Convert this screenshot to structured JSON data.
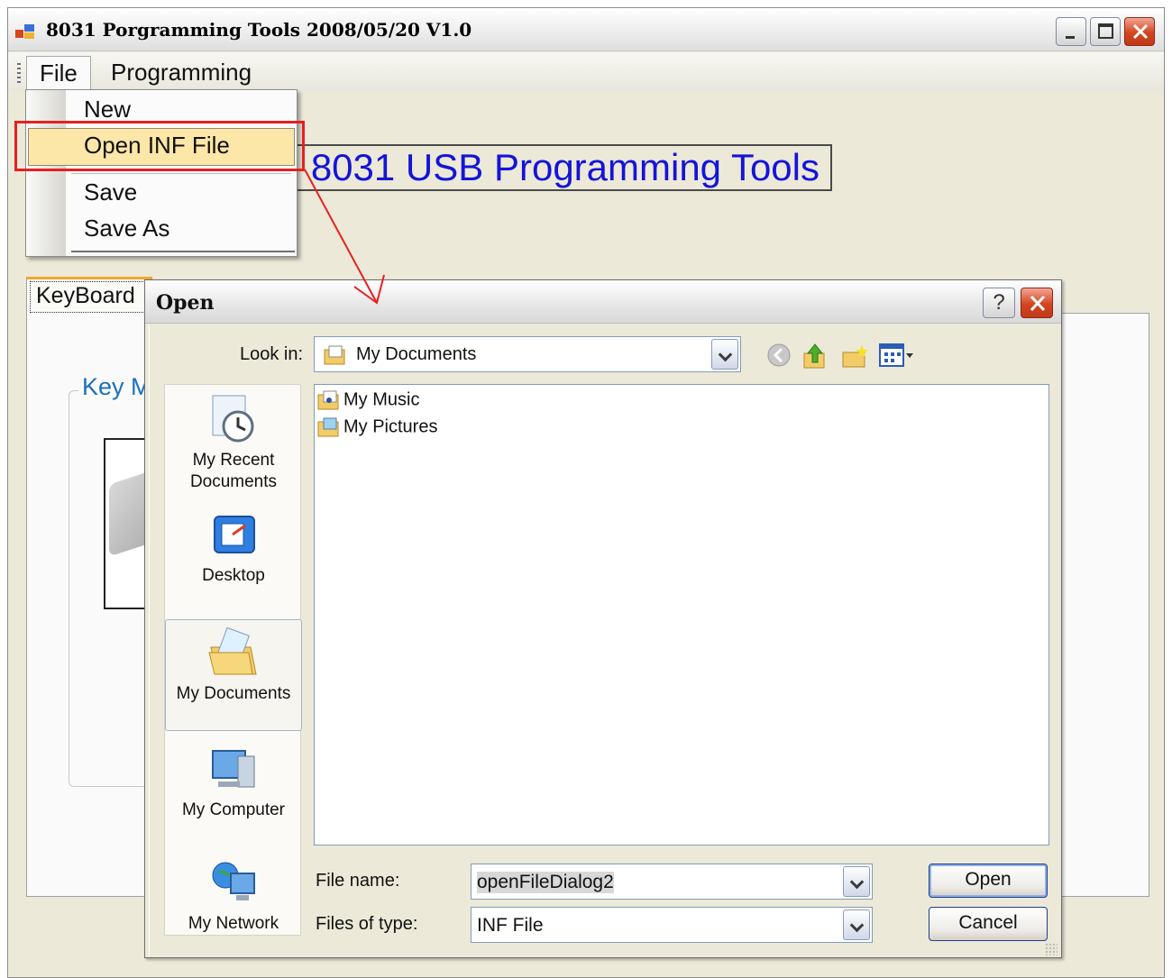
{
  "window": {
    "title": "8031 Porgramming Tools 2008/05/20 V1.0"
  },
  "menubar": {
    "file": "File",
    "programming": "Programming"
  },
  "file_menu": {
    "items": [
      "New",
      "Open INF File",
      "Save",
      "Save As"
    ],
    "highlighted": "Open INF File"
  },
  "main": {
    "heading": "8031 USB Programming Tools",
    "tab_keyboard": "KeyBoard",
    "group_label": "Key M"
  },
  "open_dialog": {
    "title": "Open",
    "help": "?",
    "look_in_label": "Look in:",
    "look_in_value": "My Documents",
    "places": [
      "My Recent Documents",
      "Desktop",
      "My Documents",
      "My Computer",
      "My Network"
    ],
    "selected_place": "My Documents",
    "files": [
      "My Music",
      "My Pictures"
    ],
    "file_name_label": "File name:",
    "file_name_value": "openFileDialog2",
    "files_of_type_label": "Files of type:",
    "files_of_type_value": "INF File",
    "open_button": "Open",
    "cancel_button": "Cancel"
  },
  "colors": {
    "heading_blue": "#1414d8",
    "group_label_blue": "#1c6ec2",
    "highlight": "#fce6a8",
    "annotation_red": "#e62020"
  }
}
